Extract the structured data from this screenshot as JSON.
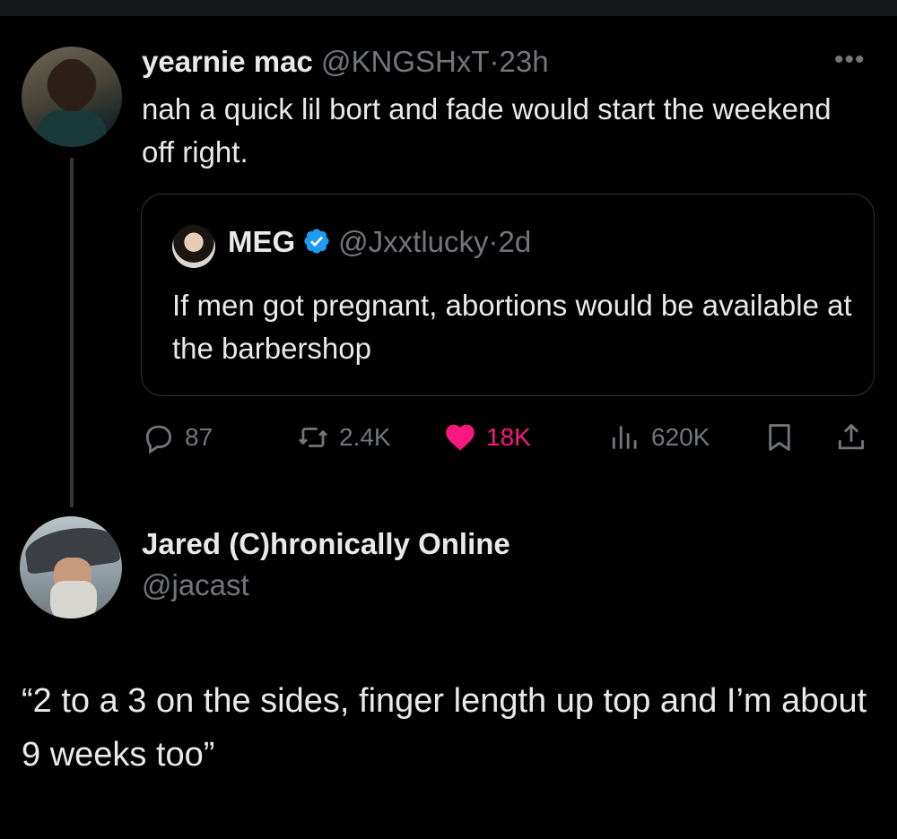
{
  "tweet1": {
    "display_name": "yearnie mac",
    "handle": "@KNGSHxT",
    "separator": "·",
    "time": "23h",
    "text": "nah a quick lil bort and fade would start the weekend off right.",
    "more_icon": "more-dots-icon"
  },
  "quote": {
    "display_name": "MEG",
    "handle": "@Jxxtlucky",
    "separator": "·",
    "time": "2d",
    "text": "If men got pregnant, abortions would be available at the barbershop",
    "verified_color": "#1d9bf0"
  },
  "actions": {
    "replies": "87",
    "reposts": "2.4K",
    "likes": "18K",
    "views": "620K",
    "like_color": "#f91880"
  },
  "tweet2": {
    "display_name": "Jared (C)hronically Online",
    "handle": "@jacast",
    "text": "“2 to a 3 on the sides, finger length up top and I’m about 9 weeks too”"
  }
}
